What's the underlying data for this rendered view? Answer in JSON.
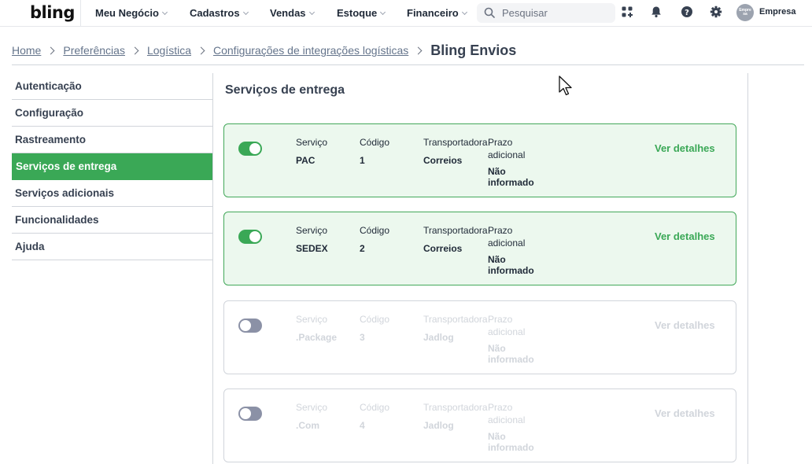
{
  "topbar": {
    "logo": "bling",
    "nav": [
      {
        "label": "Meu Negócio"
      },
      {
        "label": "Cadastros"
      },
      {
        "label": "Vendas"
      },
      {
        "label": "Estoque"
      },
      {
        "label": "Financeiro"
      }
    ],
    "search_placeholder": "Pesquisar",
    "avatar_text": "Empre sa",
    "company": "Empresa",
    "icons": [
      "apps-icon",
      "bell-icon",
      "help-icon",
      "gear-icon"
    ]
  },
  "breadcrumb": {
    "items": [
      "Home",
      "Preferências",
      "Logística",
      "Configurações de integrações logísticas"
    ],
    "current": "Bling Envios"
  },
  "sidebar": {
    "items": [
      {
        "label": "Autenticação",
        "active": false
      },
      {
        "label": "Configuração",
        "active": false
      },
      {
        "label": "Rastreamento",
        "active": false
      },
      {
        "label": "Serviços de entrega",
        "active": true
      },
      {
        "label": "Serviços adicionais",
        "active": false
      },
      {
        "label": "Funcionalidades",
        "active": false
      },
      {
        "label": "Ajuda",
        "active": false
      }
    ]
  },
  "main": {
    "title": "Serviços de entrega",
    "columns": {
      "service": "Serviço",
      "code": "Código",
      "carrier": "Transportadora",
      "deadline": "Prazo adicional"
    },
    "link_label": "Ver detalhes",
    "services": [
      {
        "enabled": true,
        "service": "PAC",
        "code": "1",
        "carrier": "Correios",
        "deadline": "Não informado"
      },
      {
        "enabled": true,
        "service": "SEDEX",
        "code": "2",
        "carrier": "Correios",
        "deadline": "Não informado"
      },
      {
        "enabled": false,
        "service": ".Package",
        "code": "3",
        "carrier": "Jadlog",
        "deadline": "Não informado"
      },
      {
        "enabled": false,
        "service": ".Com",
        "code": "4",
        "carrier": "Jadlog",
        "deadline": "Não informado"
      }
    ]
  },
  "colors": {
    "accent": "#3aa856",
    "card_active_bg": "#ecf8ee",
    "toggle_off": "#8b91a6"
  }
}
